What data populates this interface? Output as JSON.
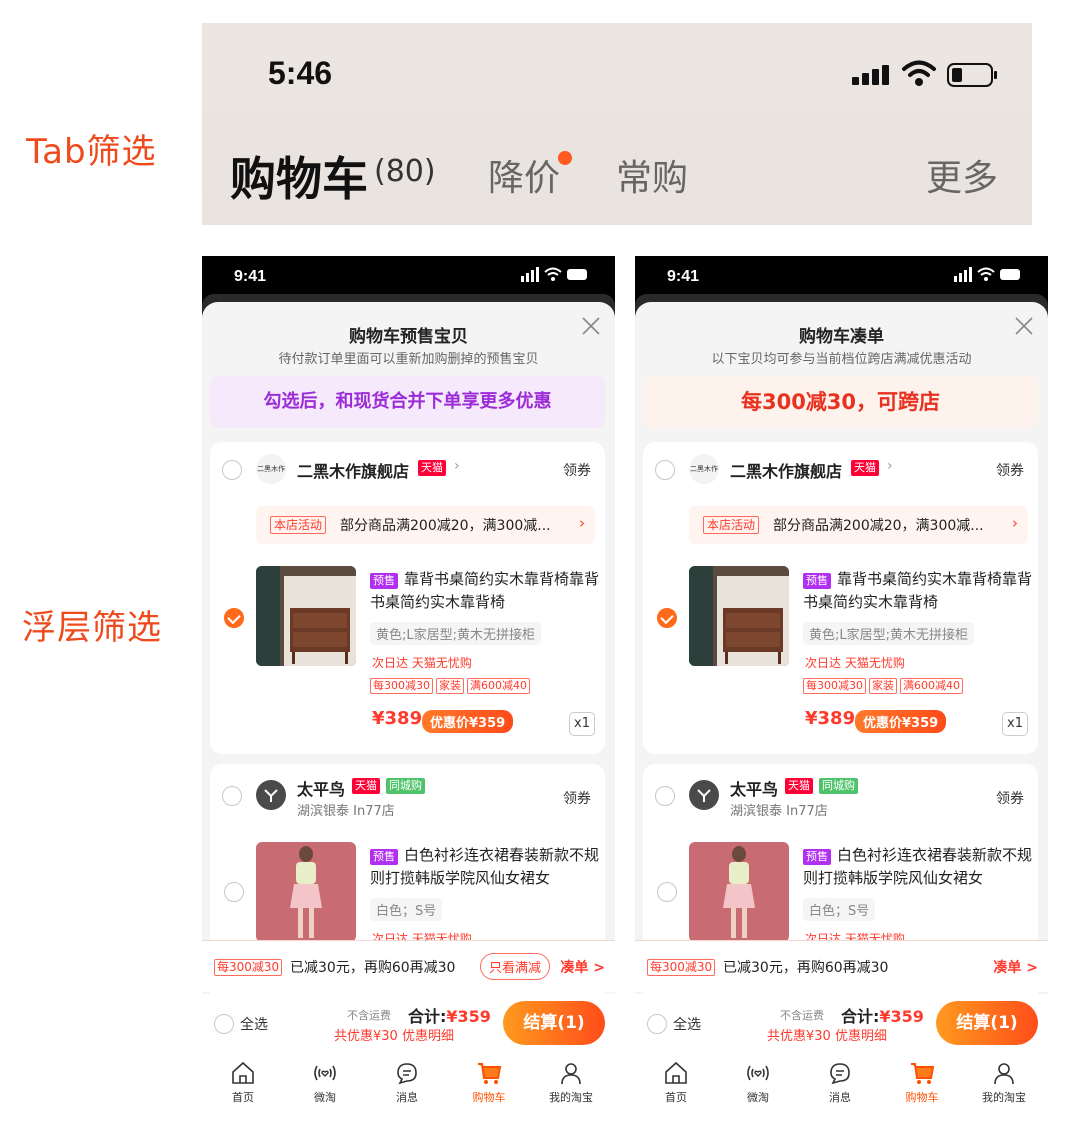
{
  "annotations": {
    "tab_filter": "Tab筛选",
    "overlay_filter": "浮层筛选"
  },
  "top_shot": {
    "time": "5:46",
    "tabs": {
      "cart": "购物车",
      "count": "(80)",
      "price_drop": "降价",
      "frequent": "常购",
      "more": "更多"
    }
  },
  "phones": [
    {
      "time": "9:41",
      "title": "购物车预售宝贝",
      "subtitle": "待付款订单里面可以重新加购删掉的预售宝贝",
      "banner": "勾选后，和现货合并下单享更多优惠",
      "banner_color": "#9b2cd8",
      "banner_bg": "#f6e9fb",
      "shop1": {
        "logo": "二黑木作",
        "name": "二黑木作旗舰店",
        "tag": "天猫",
        "coupon": "领券",
        "promo_tag": "本店活动",
        "promo_text": "部分商品满200减20，满300减...",
        "item": {
          "presale": "预售",
          "title": "靠背书桌简约实木靠背椅靠背书桌简约实木靠背椅",
          "sku": "黄色;L家居型;黄木无拼接柜",
          "service": "次日达   天猫无忧购",
          "tags": [
            "每300减30",
            "家装",
            "满600减40"
          ],
          "price": "¥389",
          "discount_price": "优惠价¥359",
          "qty": "x1"
        }
      },
      "shop2": {
        "name": "太平鸟",
        "tag": "天猫",
        "tag2": "同城购",
        "location": "湖滨银泰 In77店",
        "coupon": "领券",
        "item": {
          "presale": "预售",
          "title": "白色衬衫连衣裙春装新款不规则打揽韩版学院风仙女裙女",
          "sku": "白色；S号",
          "service": "次日达   天猫无忧购"
        }
      },
      "summary": {
        "tag": "每300减30",
        "text": "已减30元，再购60再减30",
        "only_full": "只看满减",
        "link": "凑单 >"
      },
      "checkout": {
        "select_all": "全选",
        "ship": "不含运费",
        "total_label": "合计:",
        "total": "¥359",
        "discount": "共优惠¥30  优惠明细",
        "pay": "结算(1)"
      },
      "tabbar": [
        "首页",
        "微淘",
        "消息",
        "购物车",
        "我的淘宝"
      ]
    },
    {
      "time": "9:41",
      "title": "购物车凑单",
      "subtitle": "以下宝贝均可参与当前档位跨店满减优惠活动",
      "banner": "每300减30，可跨店",
      "banner_color": "#e8311f",
      "banner_bg": "#fdf2ec",
      "shop1": {
        "logo": "二黑木作",
        "name": "二黑木作旗舰店",
        "tag": "天猫",
        "coupon": "领券",
        "promo_tag": "本店活动",
        "promo_text": "部分商品满200减20，满300减...",
        "item": {
          "presale": "预售",
          "title": "靠背书桌简约实木靠背椅靠背书桌简约实木靠背椅",
          "sku": "黄色;L家居型;黄木无拼接柜",
          "service": "次日达   天猫无忧购",
          "tags": [
            "每300减30",
            "家装",
            "满600减40"
          ],
          "price": "¥389",
          "discount_price": "优惠价¥359",
          "qty": "x1"
        }
      },
      "shop2": {
        "name": "太平鸟",
        "tag": "天猫",
        "tag2": "同城购",
        "location": "湖滨银泰 In77店",
        "coupon": "领券",
        "item": {
          "presale": "预售",
          "title": "白色衬衫连衣裙春装新款不规则打揽韩版学院风仙女裙女",
          "sku": "白色；S号",
          "service": "次日达   天猫无忧购"
        }
      },
      "summary": {
        "tag": "每300减30",
        "text": "已减30元，再购60再减30",
        "link": "凑单 >"
      },
      "checkout": {
        "select_all": "全选",
        "ship": "不含运费",
        "total_label": "合计:",
        "total": "¥359",
        "discount": "共优惠¥30  优惠明细",
        "pay": "结算(1)"
      },
      "tabbar": [
        "首页",
        "微淘",
        "消息",
        "购物车",
        "我的淘宝"
      ]
    }
  ]
}
